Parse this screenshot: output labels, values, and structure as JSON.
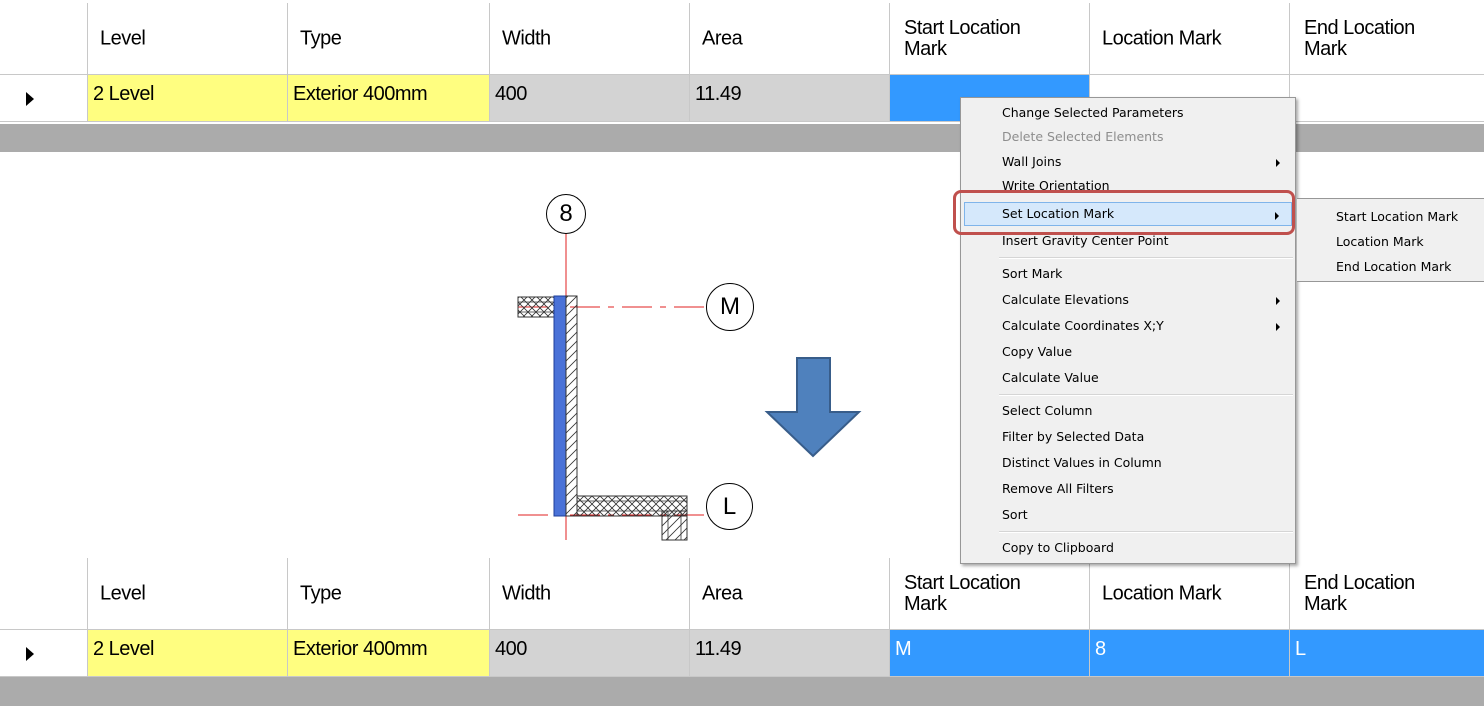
{
  "columns": [
    "Level",
    "Type",
    "Width",
    "Area",
    "Start Location\nMark",
    "Location Mark",
    "End Location\nMark"
  ],
  "top_row": {
    "level": "2 Level",
    "type": "Exterior 400mm",
    "width": "400",
    "area": "11.49",
    "start_location_mark": "",
    "location_mark": "",
    "end_location_mark": ""
  },
  "bottom_row": {
    "level": "2 Level",
    "type": "Exterior 400mm",
    "width": "400",
    "area": "11.49",
    "start_location_mark": "M",
    "location_mark": "8",
    "end_location_mark": "L"
  },
  "drawing": {
    "grid_labels": [
      "8",
      "M",
      "L"
    ],
    "wall_color": "#4a72d8",
    "arrow_color": "#4f81bd",
    "icons": [
      "down-arrow-icon"
    ]
  },
  "context_menu": {
    "items": [
      {
        "label": "Change Selected Parameters",
        "disabled": false,
        "submenu": false
      },
      {
        "label": "Delete Selected Elements",
        "disabled": true,
        "submenu": false
      },
      {
        "label": "Wall Joins",
        "disabled": false,
        "submenu": true
      },
      {
        "label": "Write Orientation",
        "disabled": false,
        "submenu": false
      },
      {
        "label": "Set Location Mark",
        "disabled": false,
        "submenu": true,
        "highlighted": true
      },
      {
        "label": "Insert Gravity Center Point",
        "disabled": false,
        "submenu": false
      },
      {
        "label": "Sort Mark",
        "disabled": false,
        "submenu": false
      },
      {
        "label": "Calculate Elevations",
        "disabled": false,
        "submenu": true
      },
      {
        "label": "Calculate Coordinates X;Y",
        "disabled": false,
        "submenu": true
      },
      {
        "label": "Copy Value",
        "disabled": false,
        "submenu": false
      },
      {
        "label": "Calculate Value",
        "disabled": false,
        "submenu": false
      },
      {
        "label": "Select Column",
        "disabled": false,
        "submenu": false
      },
      {
        "label": "Filter by Selected Data",
        "disabled": false,
        "submenu": false
      },
      {
        "label": "Distinct Values in Column",
        "disabled": false,
        "submenu": false
      },
      {
        "label": "Remove All Filters",
        "disabled": false,
        "submenu": false
      },
      {
        "label": "Sort",
        "disabled": false,
        "submenu": false
      },
      {
        "label": "Copy to Clipboard",
        "disabled": false,
        "submenu": false
      }
    ]
  },
  "submenu": {
    "items": [
      "Start Location Mark",
      "Location Mark",
      "End Location Mark"
    ]
  },
  "colors": {
    "selected_cell": "#3399ff",
    "level_type_cell": "#fffe80",
    "readonly_cell": "#d3d3d3",
    "highlight_box": "#c0504d"
  }
}
